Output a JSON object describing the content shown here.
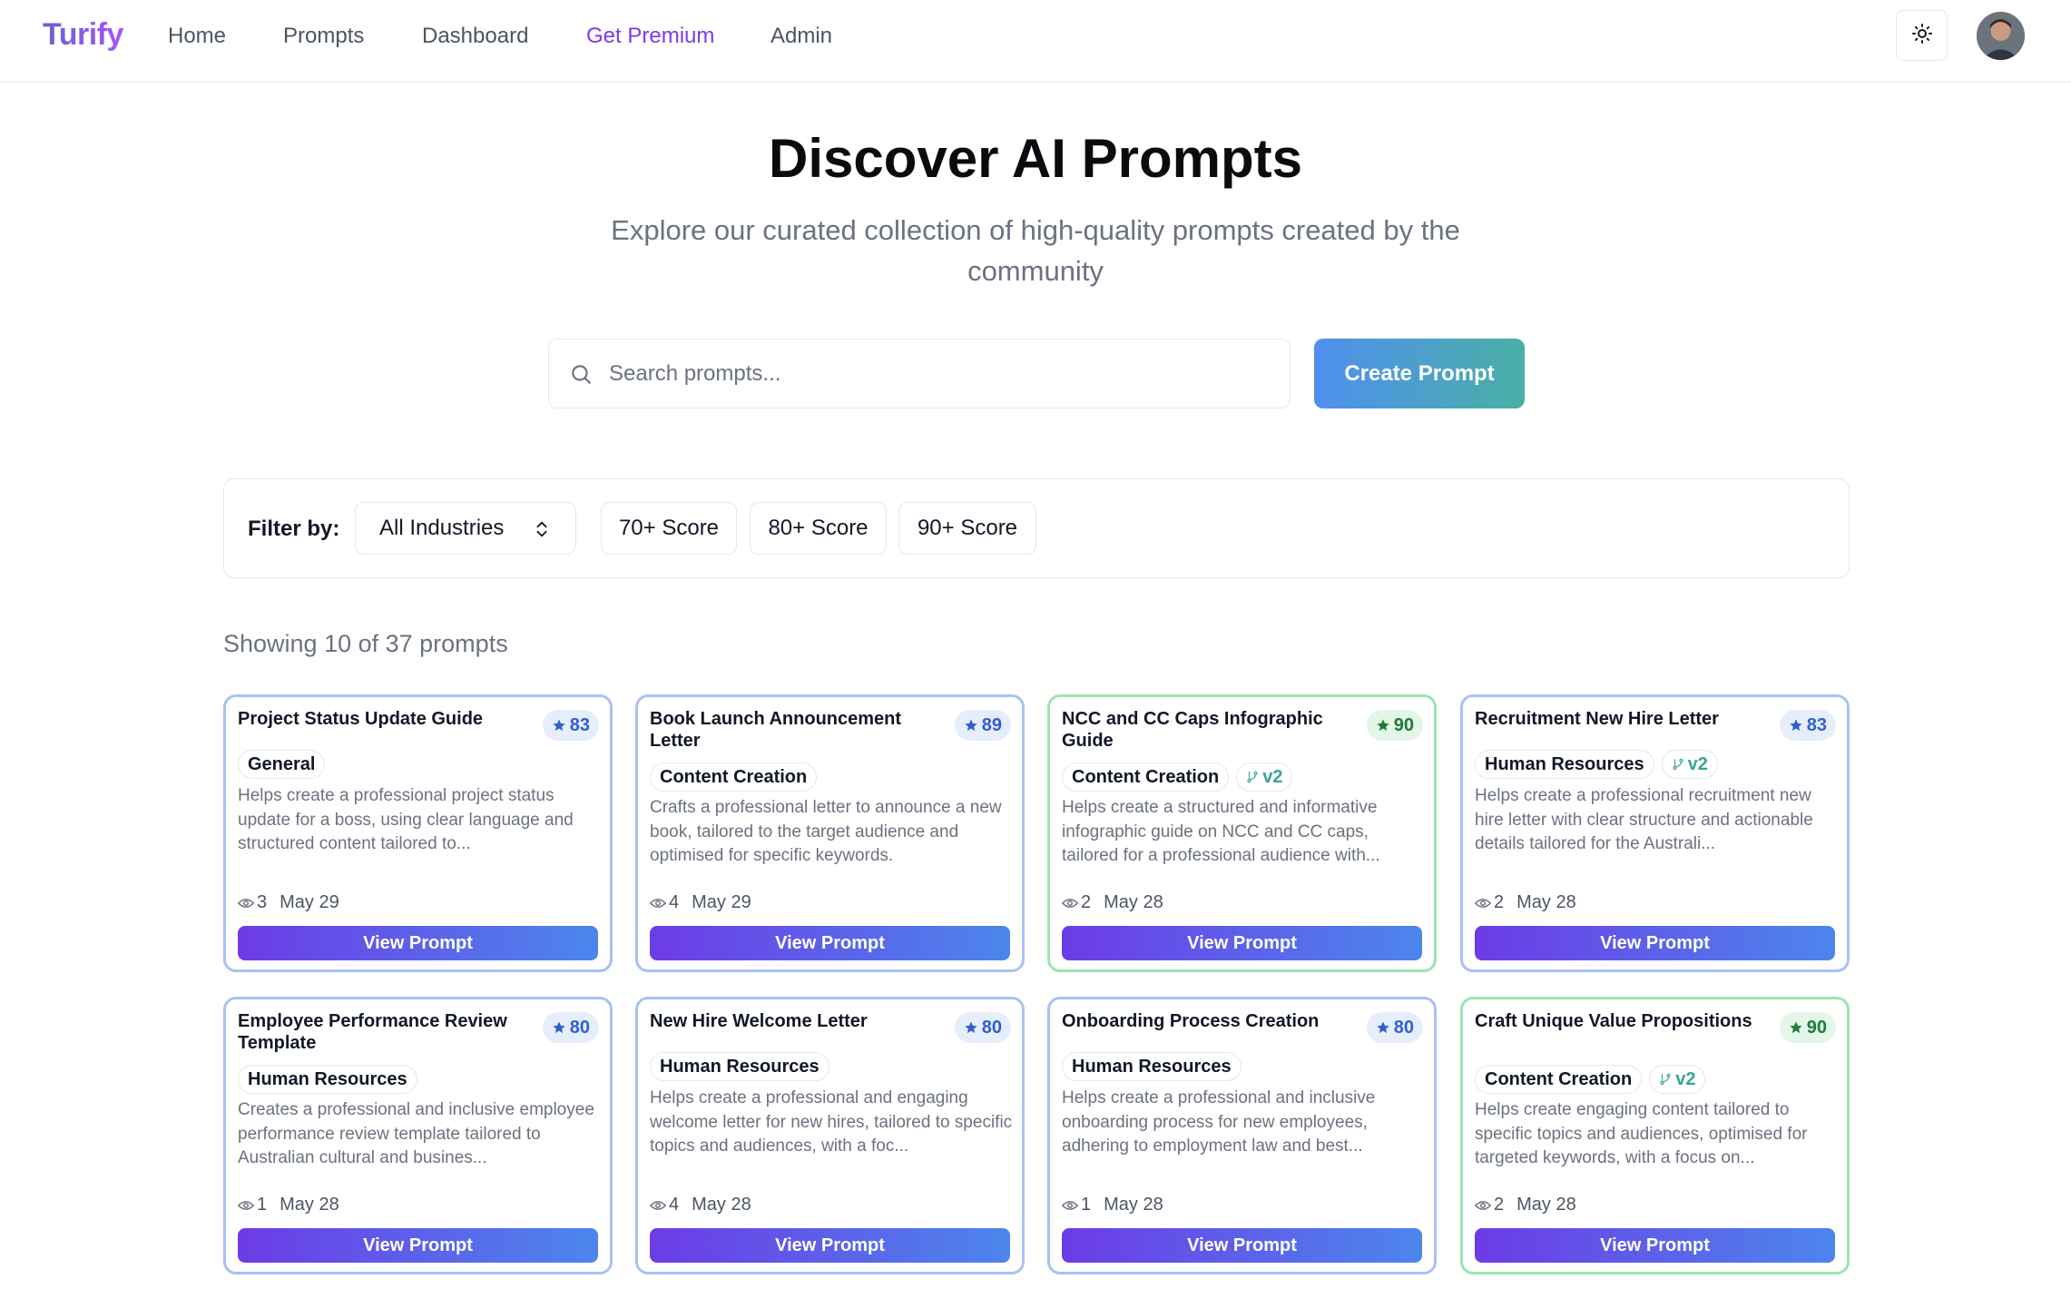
{
  "nav": {
    "brand": "Turify",
    "links": [
      {
        "label": "Home"
      },
      {
        "label": "Prompts"
      },
      {
        "label": "Dashboard"
      },
      {
        "label": "Get Premium"
      },
      {
        "label": "Admin"
      }
    ],
    "theme_icon": "sun-icon",
    "avatar_icon": "user-avatar"
  },
  "hero": {
    "title": "Discover AI Prompts",
    "subtitle": "Explore our curated collection of high-quality prompts created by the community"
  },
  "search": {
    "placeholder": "Search prompts...",
    "value": "",
    "icon": "search-icon"
  },
  "create_button": "Create Prompt",
  "filters": {
    "label": "Filter by:",
    "industry": "All Industries",
    "scores": [
      "70+ Score",
      "80+ Score",
      "90+ Score"
    ]
  },
  "showing": "Showing 10 of 37 prompts",
  "colors": {
    "accent": "#7c3aed",
    "blue_border": "#a8c2f2",
    "green_border": "#9fe3b0"
  },
  "cards": [
    {
      "title": "Project Status Update Guide",
      "score": "83",
      "tier": "blue",
      "category": "General",
      "version": "",
      "description": "Helps create a professional project status update for a boss, using clear language and structured content tailored to...",
      "views": "3",
      "date": "May 29",
      "button": "View Prompt"
    },
    {
      "title": "Book Launch Announcement Letter",
      "score": "89",
      "tier": "blue",
      "category": "Content Creation",
      "version": "",
      "description": "Crafts a professional letter to announce a new book, tailored to the target audience and optimised for specific keywords.",
      "views": "4",
      "date": "May 29",
      "button": "View Prompt"
    },
    {
      "title": "NCC and CC Caps Infographic Guide",
      "score": "90",
      "tier": "green",
      "category": "Content Creation",
      "version": "v2",
      "description": "Helps create a structured and informative infographic guide on NCC and CC caps, tailored for a professional audience with...",
      "views": "2",
      "date": "May 28",
      "button": "View Prompt"
    },
    {
      "title": "Recruitment New Hire Letter",
      "score": "83",
      "tier": "blue",
      "category": "Human Resources",
      "version": "v2",
      "description": "Helps create a professional recruitment new hire letter with clear structure and actionable details tailored for the Australi...",
      "views": "2",
      "date": "May 28",
      "button": "View Prompt"
    },
    {
      "title": "Employee Performance Review Template",
      "score": "80",
      "tier": "blue",
      "category": "Human Resources",
      "version": "",
      "description": "Creates a professional and inclusive employee performance review template tailored to Australian cultural and busines...",
      "views": "1",
      "date": "May 28",
      "button": "View Prompt"
    },
    {
      "title": "New Hire Welcome Letter",
      "score": "80",
      "tier": "blue",
      "category": "Human Resources",
      "version": "",
      "description": "Helps create a professional and engaging welcome letter for new hires, tailored to specific topics and audiences, with a foc...",
      "views": "4",
      "date": "May 28",
      "button": "View Prompt"
    },
    {
      "title": "Onboarding Process Creation",
      "score": "80",
      "tier": "blue",
      "category": "Human Resources",
      "version": "",
      "description": "Helps create a professional and inclusive onboarding process for new employees, adhering to employment law and best...",
      "views": "1",
      "date": "May 28",
      "button": "View Prompt"
    },
    {
      "title": "Craft Unique Value Propositions",
      "score": "90",
      "tier": "green",
      "category": "Content Creation",
      "version": "v2",
      "description": "Helps create engaging content tailored to specific topics and audiences, optimised for targeted keywords, with a focus on...",
      "views": "2",
      "date": "May 28",
      "button": "View Prompt"
    }
  ]
}
